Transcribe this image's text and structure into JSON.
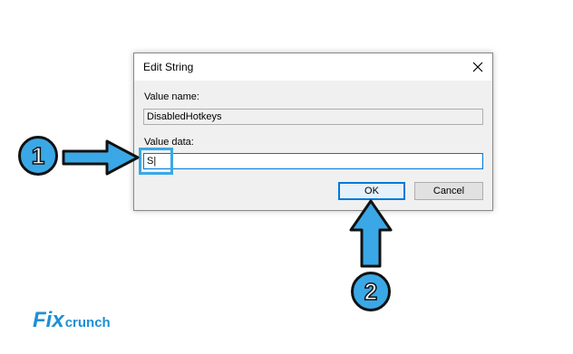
{
  "dialog": {
    "title": "Edit String",
    "value_name_label": "Value name:",
    "value_name": "DisabledHotkeys",
    "value_data_label": "Value data:",
    "value_data": "S|",
    "ok_label": "OK",
    "cancel_label": "Cancel"
  },
  "callouts": {
    "step1": "1",
    "step2": "2",
    "accent_color": "#3aa8e6"
  },
  "logo": {
    "part1": "Fix",
    "part2": "crunch"
  }
}
